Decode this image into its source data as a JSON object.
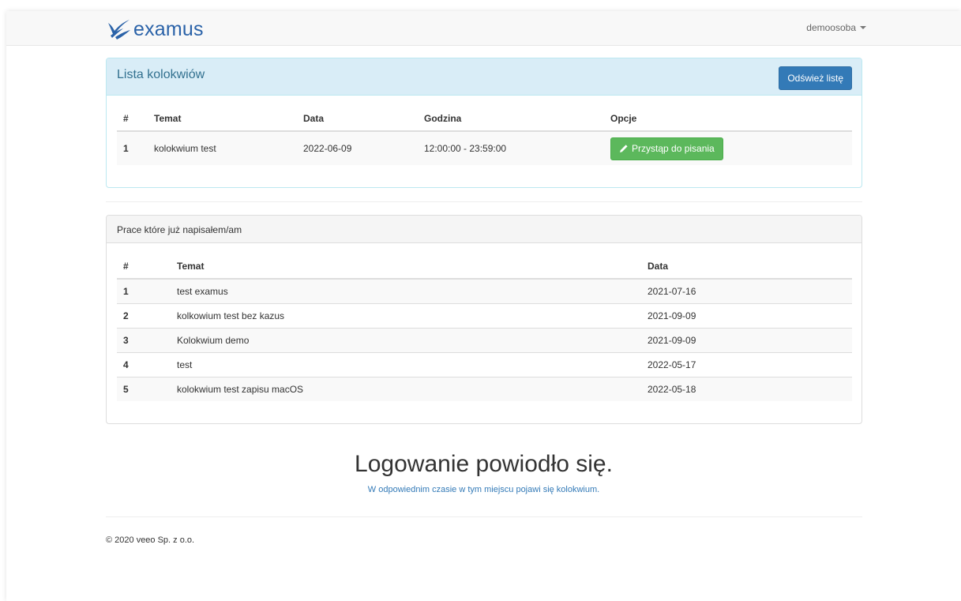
{
  "brand": {
    "name": "examus",
    "color": "#2a62a8"
  },
  "user": {
    "name": "demoosoba"
  },
  "exam_panel": {
    "title": "Lista kolokwiów",
    "refresh_label": "Odśwież listę",
    "columns": [
      "#",
      "Temat",
      "Data",
      "Godzina",
      "Opcje"
    ],
    "rows": [
      {
        "num": "1",
        "topic": "kolokwium test",
        "date": "2022-06-09",
        "time": "12:00:00 - 23:59:00",
        "action": "Przystąp do pisania"
      }
    ]
  },
  "done_panel": {
    "title": "Prace które już napisałem/am",
    "columns": [
      "#",
      "Temat",
      "Data"
    ],
    "rows": [
      {
        "num": "1",
        "topic": "test examus",
        "date": "2021-07-16"
      },
      {
        "num": "2",
        "topic": "kolkowium test bez kazus",
        "date": "2021-09-09"
      },
      {
        "num": "3",
        "topic": "Kolokwium demo",
        "date": "2021-09-09"
      },
      {
        "num": "4",
        "topic": "test",
        "date": "2022-05-17"
      },
      {
        "num": "5",
        "topic": "kolokwium test zapisu macOS",
        "date": "2022-05-18"
      }
    ]
  },
  "message": {
    "title": "Logowanie powiodło się.",
    "subtitle": "W odpowiednim czasie w tym miejscu pojawi się kolokwium."
  },
  "footer": {
    "text": "© 2020 veeo Sp. z o.o."
  },
  "icons": {
    "logo": "checkmark-swoosh-logo-icon",
    "user_caret": "caret-down-icon",
    "pencil": "pencil-icon"
  },
  "colors": {
    "primary": "#337ab7",
    "success": "#5cb85c",
    "info_bg": "#d9edf7",
    "info_text": "#31708f"
  }
}
